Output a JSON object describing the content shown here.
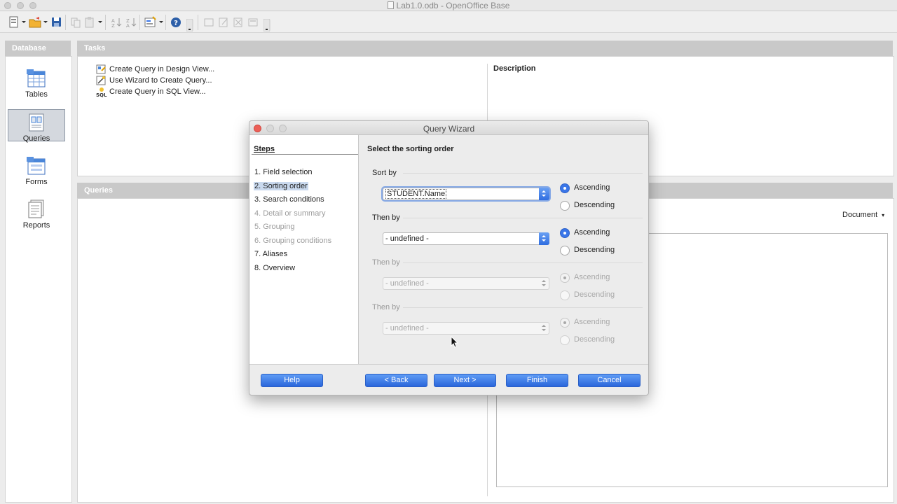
{
  "window": {
    "title": "Lab1.0.odb - OpenOffice Base"
  },
  "toolbar": {
    "help_symbol": "?"
  },
  "sidebar": {
    "header": "Database",
    "items": [
      {
        "label": "Tables",
        "active": false,
        "icon": "tables-icon"
      },
      {
        "label": "Queries",
        "active": true,
        "icon": "queries-icon"
      },
      {
        "label": "Forms",
        "active": false,
        "icon": "forms-icon"
      },
      {
        "label": "Reports",
        "active": false,
        "icon": "reports-icon"
      }
    ]
  },
  "tasks": {
    "header": "Tasks",
    "items": [
      {
        "label": "Create Query in Design View...",
        "icon": "design-view-icon"
      },
      {
        "label": "Use Wizard to Create Query...",
        "icon": "wizard-icon"
      },
      {
        "label": "Create Query in SQL View...",
        "icon": "sql-view-icon"
      }
    ],
    "description_label": "Description"
  },
  "queries": {
    "header": "Queries",
    "preview_mode": "Document"
  },
  "dialog": {
    "title": "Query Wizard",
    "steps_heading": "Steps",
    "steps": [
      {
        "label": "1. Field selection",
        "state": "enabled"
      },
      {
        "label": "2. Sorting order",
        "state": "current"
      },
      {
        "label": "3. Search conditions",
        "state": "enabled"
      },
      {
        "label": "4. Detail or summary",
        "state": "disabled"
      },
      {
        "label": "5. Grouping",
        "state": "disabled"
      },
      {
        "label": "6. Grouping conditions",
        "state": "disabled"
      },
      {
        "label": "7. Aliases",
        "state": "enabled"
      },
      {
        "label": "8. Overview",
        "state": "enabled"
      }
    ],
    "heading": "Select the sorting order",
    "sort_groups": [
      {
        "label": "Sort by",
        "value": "STUDENT.Name",
        "enabled": true,
        "ascending": "Ascending",
        "descending": "Descending",
        "selected": "ascending"
      },
      {
        "label": "Then by",
        "value": "- undefined -",
        "enabled": true,
        "ascending": "Ascending",
        "descending": "Descending",
        "selected": "ascending"
      },
      {
        "label": "Then by",
        "value": "- undefined -",
        "enabled": false,
        "ascending": "Ascending",
        "descending": "Descending",
        "selected": "ascending"
      },
      {
        "label": "Then by",
        "value": "- undefined -",
        "enabled": false,
        "ascending": "Ascending",
        "descending": "Descending",
        "selected": "ascending"
      }
    ],
    "buttons": {
      "help": "Help",
      "back": "< Back",
      "next": "Next >",
      "finish": "Finish",
      "cancel": "Cancel"
    }
  },
  "colors": {
    "accent": "#3a76e8",
    "close": "#ec5f57",
    "panel_header": "#c9c9c9"
  }
}
